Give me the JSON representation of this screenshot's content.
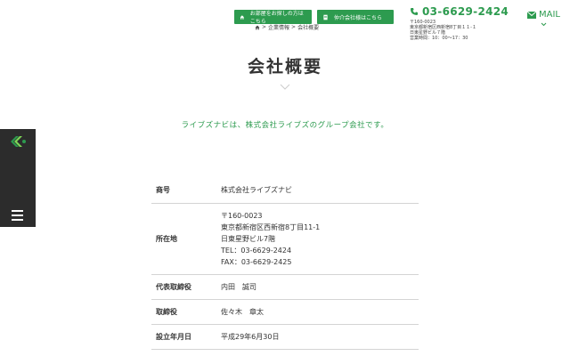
{
  "header": {
    "inquiry_button": "お部屋をお探しの方はこちら",
    "realtor_button": "仲介会社様はこちら",
    "tel": "03-6629-2424",
    "address_lines": [
      "〒160-0023",
      "東京都新宿区西新宿8丁目１１-１",
      "日東星野ビル７階",
      "営業時間：10：00〜17：30"
    ],
    "mail_label": "MAIL"
  },
  "breadcrumb": {
    "items": [
      "企業情報",
      "会社概要"
    ],
    "separator": ">"
  },
  "page_title": "会社概要",
  "intro_text": "ライブズナビは、株式会社ライブズのグループ会社です。",
  "company_info": {
    "rows": [
      {
        "label": "商号",
        "values": [
          "株式会社ライブズナビ"
        ]
      },
      {
        "label": "所在地",
        "values": [
          "〒160-0023",
          "東京都新宿区西新宿8丁目11-1",
          "日東星野ビル7階",
          "TEL：03-6629-2424",
          "FAX：03-6629-2425"
        ]
      },
      {
        "label": "代表取締役",
        "values": [
          "内田　誠司"
        ]
      },
      {
        "label": "取締役",
        "values": [
          "佐々木　章太"
        ]
      },
      {
        "label": "設立年月日",
        "values": [
          "平成29年6月30日"
        ]
      }
    ]
  },
  "colors": {
    "accent": "#2d9b4f",
    "sidebar": "#2c2c2c",
    "text": "#333333",
    "divider": "#d4d4d4"
  },
  "icons": {
    "inquiry": "home-icon",
    "realtor": "document-icon",
    "tel": "phone-icon",
    "mail": "mail-icon",
    "breadcrumb_home": "home-icon",
    "title_divider": "chevron-down-icon",
    "menu": "hamburger-menu-icon"
  }
}
